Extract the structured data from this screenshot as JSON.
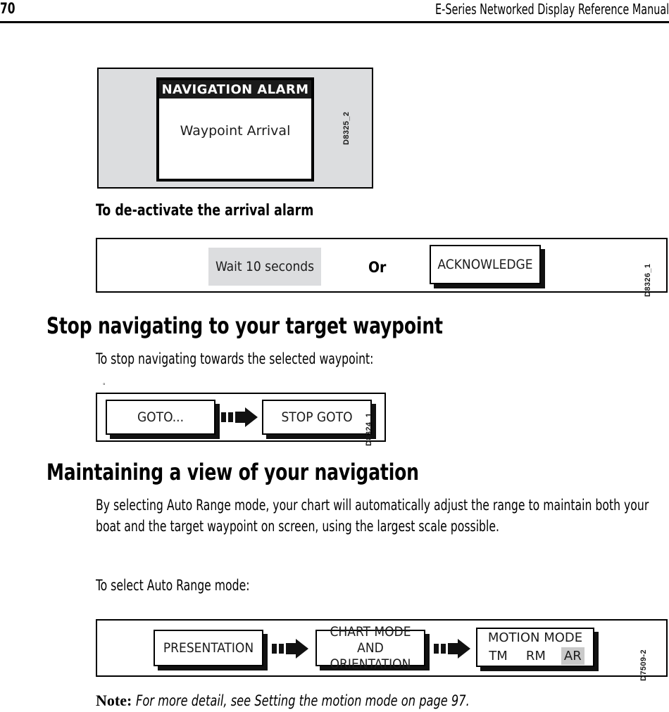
{
  "header": {
    "page_number": "70",
    "manual_title": "E-Series Networked Display Reference Manual"
  },
  "figure_alarm": {
    "id_label": "D8325_2",
    "dialog_title": "NAVIGATION ALARM",
    "dialog_message": "Waypoint Arrival"
  },
  "section_deactivate": {
    "heading": "To de-activate the arrival alarm",
    "figure": {
      "id_label": "D8326_1",
      "wait_option": "Wait 10 seconds",
      "conjunction": "Or",
      "acknowledge_button": "ACKNOWLEDGE"
    }
  },
  "section_stop_nav": {
    "heading": "Stop navigating to your target waypoint",
    "intro": "To stop navigating towards the selected waypoint:",
    "figure": {
      "id_label": "D8324_1",
      "step1": "GOTO...",
      "step2": "STOP GOTO",
      "arrow_icon": "step-arrow-icon"
    }
  },
  "section_maintain_view": {
    "heading": "Maintaining a view of your navigation",
    "paragraph": "By selecting Auto Range mode, your chart will automatically adjust the range to maintain both your boat and the target waypoint on screen, using the largest scale possible.",
    "intro": "To select Auto Range mode:",
    "figure": {
      "id_label": "D7509-2",
      "step1": "PRESENTATION",
      "step2_line1": "CHART MODE AND",
      "step2_line2": "ORIENTATION",
      "step3_title": "MOTION MODE",
      "step3_options": [
        "TM",
        "RM",
        "AR"
      ],
      "step3_selected": "AR",
      "arrow_icon": "step-arrow-icon"
    }
  },
  "note": {
    "label": "Note:",
    "text": "For more detail, see Setting the motion mode on page 97."
  },
  "colors": {
    "figure_panel_gray": "#dcdddf",
    "selected_highlight": "#c9c9c9",
    "ink": "#000000"
  }
}
